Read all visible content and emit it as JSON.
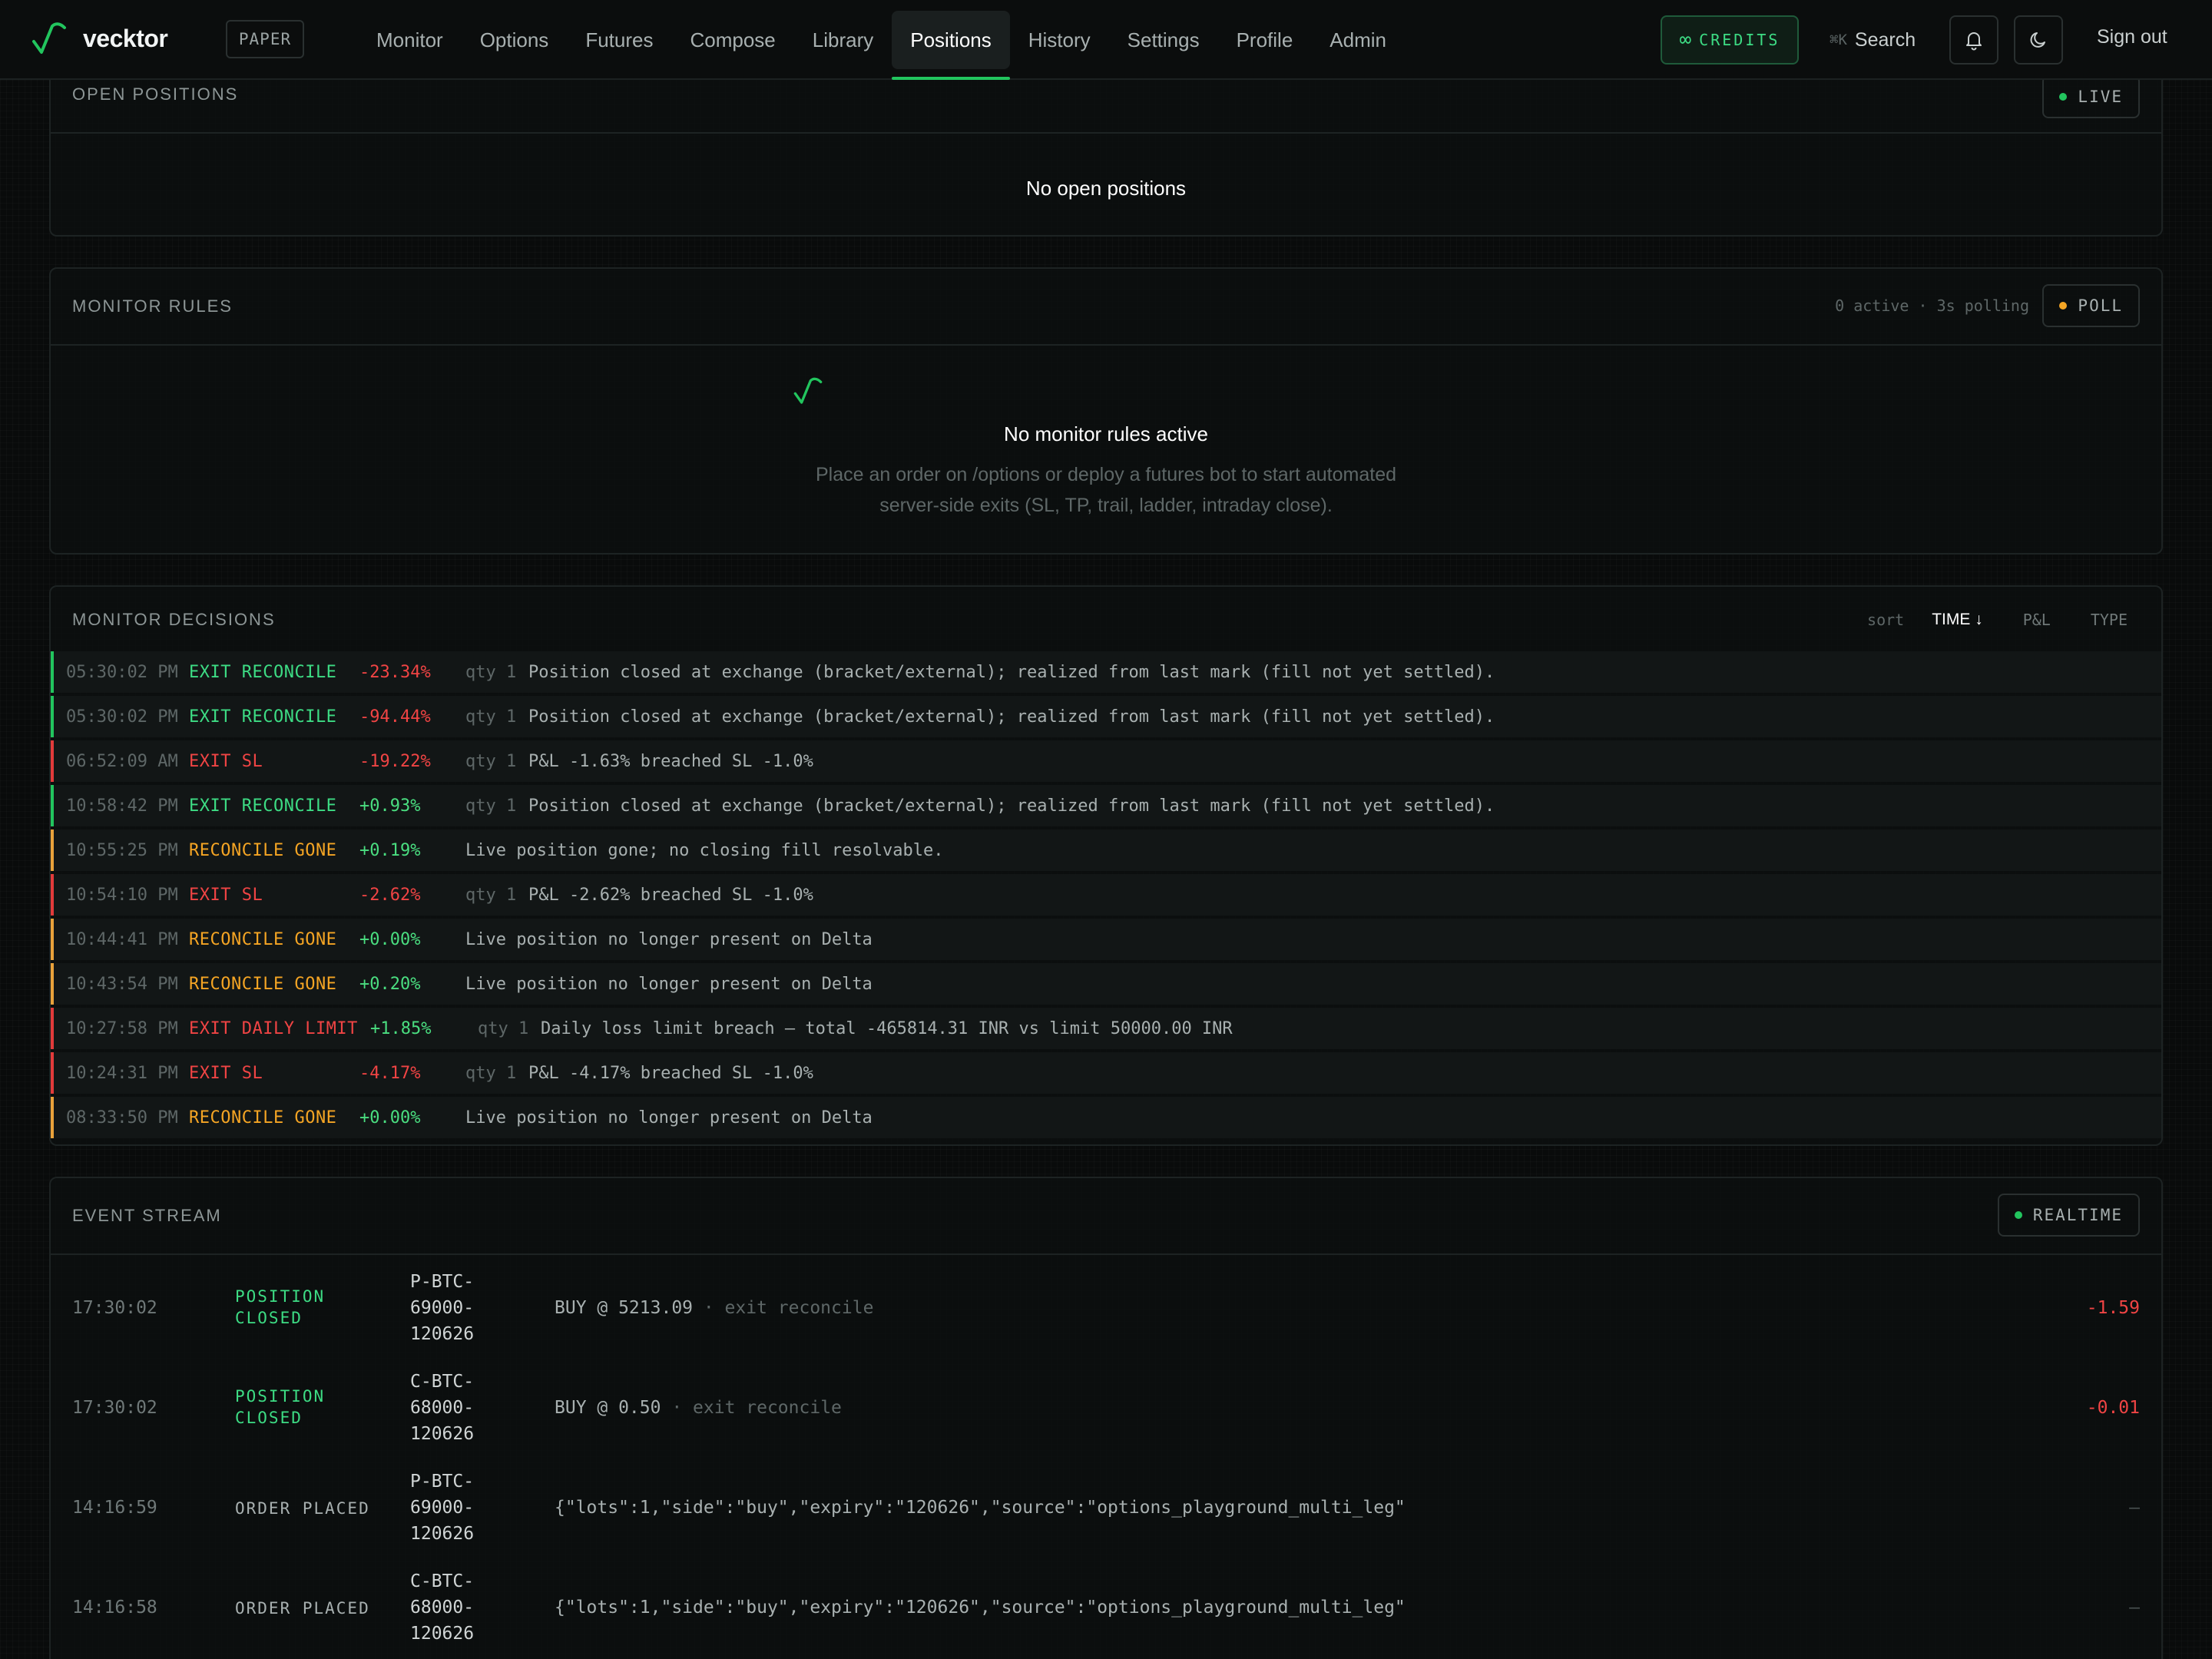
{
  "nav": {
    "brand": "vecktor",
    "mode_badge": "PAPER",
    "links": [
      "Monitor",
      "Options",
      "Futures",
      "Compose",
      "Library",
      "Positions",
      "History",
      "Settings",
      "Profile",
      "Admin"
    ],
    "active": "Positions",
    "credits_symbol": "∞",
    "credits_label": "CREDITS",
    "search_shortcut": "⌘K",
    "search_label": "Search",
    "sign_out": "Sign out"
  },
  "colors": {
    "accent": "#22c55e",
    "loss": "#f04444",
    "gain": "#4ade80",
    "warn": "#f5a524"
  },
  "open_positions": {
    "title": "OPEN POSITIONS",
    "status": "LIVE",
    "empty": "No open positions"
  },
  "monitor_rules": {
    "title": "MONITOR RULES",
    "meta": "0 active · 3s polling",
    "status": "POLL",
    "empty_title": "No monitor rules active",
    "empty_line1": "Place an order on /options or deploy a futures bot to start automated",
    "empty_line2": "server-side exits (SL, TP, trail, ladder, intraday close)."
  },
  "monitor_decisions": {
    "title": "MONITOR DECISIONS",
    "sort_label": "sort",
    "sort_options": [
      "TIME ↓",
      "P&L",
      "TYPE"
    ],
    "sort_active": "TIME ↓",
    "rows": [
      {
        "time": "05:30:02 PM",
        "kind": "EXIT RECONCILE",
        "tone": "gain",
        "pnl": "-23.34%",
        "pnl_tone": "loss",
        "qty": "qty 1",
        "msg": "Position closed at exchange (bracket/external); realized from last mark (fill not yet settled)."
      },
      {
        "time": "05:30:02 PM",
        "kind": "EXIT RECONCILE",
        "tone": "gain",
        "pnl": "-94.44%",
        "pnl_tone": "loss",
        "qty": "qty 1",
        "msg": "Position closed at exchange (bracket/external); realized from last mark (fill not yet settled)."
      },
      {
        "time": "06:52:09 AM",
        "kind": "EXIT SL",
        "tone": "loss",
        "pnl": "-19.22%",
        "pnl_tone": "loss",
        "qty": "qty 1",
        "msg": "P&L -1.63% breached SL -1.0%"
      },
      {
        "time": "10:58:42 PM",
        "kind": "EXIT RECONCILE",
        "tone": "gain",
        "pnl": "+0.93%",
        "pnl_tone": "gain",
        "qty": "qty 1",
        "msg": "Position closed at exchange (bracket/external); realized from last mark (fill not yet settled)."
      },
      {
        "time": "10:55:25 PM",
        "kind": "RECONCILE GONE",
        "tone": "warn",
        "pnl": "+0.19%",
        "pnl_tone": "gain",
        "qty": "",
        "msg": "Live position gone; no closing fill resolvable."
      },
      {
        "time": "10:54:10 PM",
        "kind": "EXIT SL",
        "tone": "loss",
        "pnl": "-2.62%",
        "pnl_tone": "loss",
        "qty": "qty 1",
        "msg": "P&L -2.62% breached SL -1.0%"
      },
      {
        "time": "10:44:41 PM",
        "kind": "RECONCILE GONE",
        "tone": "warn",
        "pnl": "+0.00%",
        "pnl_tone": "gain",
        "qty": "",
        "msg": "Live position no longer present on Delta"
      },
      {
        "time": "10:43:54 PM",
        "kind": "RECONCILE GONE",
        "tone": "warn",
        "pnl": "+0.20%",
        "pnl_tone": "gain",
        "qty": "",
        "msg": "Live position no longer present on Delta"
      },
      {
        "time": "10:27:58 PM",
        "kind": "EXIT DAILY LIMIT",
        "tone": "loss",
        "pnl": "+1.85%",
        "pnl_tone": "gain",
        "qty": "qty 1",
        "msg": "Daily loss limit breach — total -465814.31 INR vs limit 50000.00 INR"
      },
      {
        "time": "10:24:31 PM",
        "kind": "EXIT SL",
        "tone": "loss",
        "pnl": "-4.17%",
        "pnl_tone": "loss",
        "qty": "qty 1",
        "msg": "P&L -4.17% breached SL -1.0%"
      },
      {
        "time": "08:33:50 PM",
        "kind": "RECONCILE GONE",
        "tone": "warn",
        "pnl": "+0.00%",
        "pnl_tone": "gain",
        "qty": "",
        "msg": "Live position no longer present on Delta"
      }
    ]
  },
  "event_stream": {
    "title": "EVENT STREAM",
    "status": "REALTIME",
    "rows": [
      {
        "time": "17:30:02",
        "kind": [
          "POSITION",
          "CLOSED"
        ],
        "tone": "gain",
        "inst": [
          "P-BTC-",
          "69000-",
          "120626"
        ],
        "desc": "BUY @ 5213.09",
        "desc_muted": " · exit reconcile",
        "value": "-1.59",
        "value_tone": "loss"
      },
      {
        "time": "17:30:02",
        "kind": [
          "POSITION",
          "CLOSED"
        ],
        "tone": "gain",
        "inst": [
          "C-BTC-",
          "68000-",
          "120626"
        ],
        "desc": "BUY @ 0.50",
        "desc_muted": " · exit reconcile",
        "value": "-0.01",
        "value_tone": "loss"
      },
      {
        "time": "14:16:59",
        "kind": [
          "ORDER PLACED",
          ""
        ],
        "tone": "neutral",
        "inst": [
          "P-BTC-",
          "69000-",
          "120626"
        ],
        "desc": "{\"lots\":1,\"side\":\"buy\",\"expiry\":\"120626\",\"source\":\"options_playground_multi_leg\"",
        "desc_muted": "",
        "value": "–",
        "value_tone": "muted"
      },
      {
        "time": "14:16:58",
        "kind": [
          "ORDER PLACED",
          ""
        ],
        "tone": "neutral",
        "inst": [
          "C-BTC-",
          "68000-",
          "120626"
        ],
        "desc": "{\"lots\":1,\"side\":\"buy\",\"expiry\":\"120626\",\"source\":\"options_playground_multi_leg\"",
        "desc_muted": "",
        "value": "–",
        "value_tone": "muted"
      }
    ]
  }
}
